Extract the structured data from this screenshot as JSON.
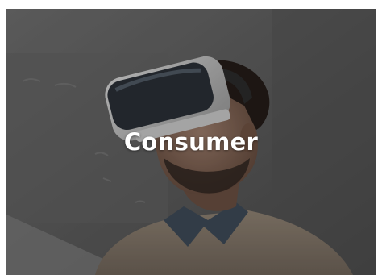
{
  "tile": {
    "title": "Consumer",
    "image_subject": "man-wearing-vr-headset-photo"
  }
}
